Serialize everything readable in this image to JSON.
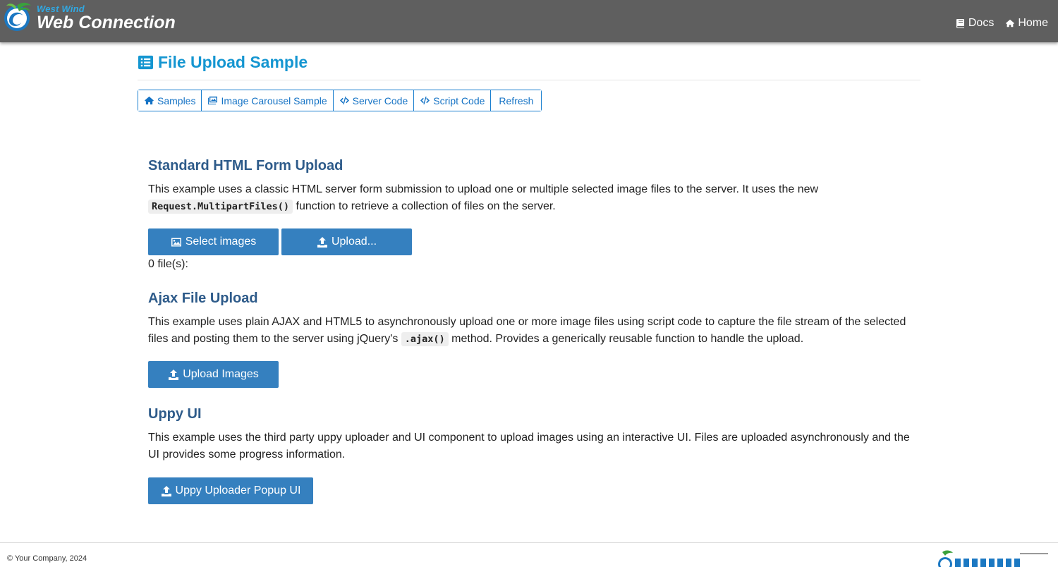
{
  "brand": {
    "sub": "West Wind",
    "main": "Web Connection"
  },
  "topnav": [
    {
      "label": "Docs",
      "icon": "book-icon"
    },
    {
      "label": "Home",
      "icon": "home-icon"
    }
  ],
  "page": {
    "title": "File Upload Sample"
  },
  "toolbar": [
    {
      "label": "Samples",
      "icon": "home-icon"
    },
    {
      "label": "Image Carousel Sample",
      "icon": "images-icon"
    },
    {
      "label": "Server Code",
      "icon": "code-icon"
    },
    {
      "label": "Script Code",
      "icon": "code-icon"
    },
    {
      "label": "Refresh",
      "icon": ""
    }
  ],
  "sections": {
    "standard": {
      "title": "Standard HTML Form Upload",
      "text_before": "This example uses a classic HTML server form submission to upload one or multiple selected image files to the server. It uses the new",
      "code": "Request.MultipartFiles()",
      "text_after": "function to retrieve a collection of files on the server.",
      "select_label": "Select images",
      "upload_label": "Upload...",
      "file_count": "0 file(s):"
    },
    "ajax": {
      "title": "Ajax File Upload",
      "text_before": "This example uses plain AJAX and HTML5 to asynchronously upload one or more image files using script code to capture the file stream of the selected files and posting them to the server using jQuery's",
      "code": ".ajax()",
      "text_after": "method. Provides a generically reusable function to handle the upload.",
      "button_label": "Upload Images"
    },
    "uppy": {
      "title": "Uppy UI",
      "text": "This example uses the third party uppy uploader and UI component to upload images using an interactive UI. Files are uploaded asynchronously and the UI provides some progress information.",
      "button_label": "Uppy Uploader Popup UI"
    }
  },
  "footer": {
    "copyright": "© Your Company, 2024"
  },
  "colors": {
    "topbar": "#5f5f5f",
    "accent": "#1596d1",
    "button": "#3580bf",
    "section_title": "#2e5b8a",
    "link": "#1573c5"
  }
}
